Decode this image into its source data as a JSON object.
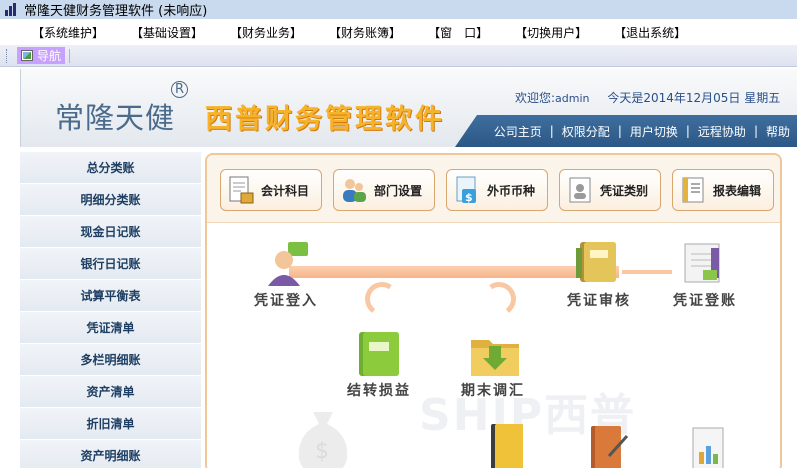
{
  "window": {
    "title": "常隆天健财务管理软件 (未响应)"
  },
  "menu": [
    "【系统维护】",
    "【基础设置】",
    "【财务业务】",
    "【财务账簿】",
    "【窗　口】",
    "【切换用户】",
    "【退出系统】"
  ],
  "navbar": {
    "nav_label": "导航"
  },
  "header": {
    "brand": "常隆天健",
    "reg_mark": "R",
    "product": "西普财务管理软件",
    "welcome_label": "欢迎您:",
    "user": "admin",
    "date_text": "今天是2014年12月05日 星期五",
    "links": [
      "公司主页",
      "权限分配",
      "用户切换",
      "远程协助",
      "帮助"
    ],
    "link_separator": "|"
  },
  "sidebar": {
    "items": [
      "总分类账",
      "明细分类账",
      "现金日记账",
      "银行日记账",
      "试算平衡表",
      "凭证清单",
      "多栏明细账",
      "资产清单",
      "折旧清单",
      "资产明细账"
    ]
  },
  "toolbar": {
    "buttons": [
      "会计科目",
      "部门设置",
      "外币币种",
      "凭证类别",
      "报表编辑"
    ]
  },
  "flow": {
    "labels": {
      "entry": "凭证登入",
      "audit": "凭证审核",
      "post": "凭证登账",
      "transfer": "结转损益",
      "adjust": "期末调汇"
    },
    "watermark": "SHIP西普"
  },
  "colors": {
    "accent_blue": "#2b5785",
    "product_orange": "#f6b22a",
    "panel_border": "#efc79a",
    "nav_purple": "#c8a0ff"
  }
}
